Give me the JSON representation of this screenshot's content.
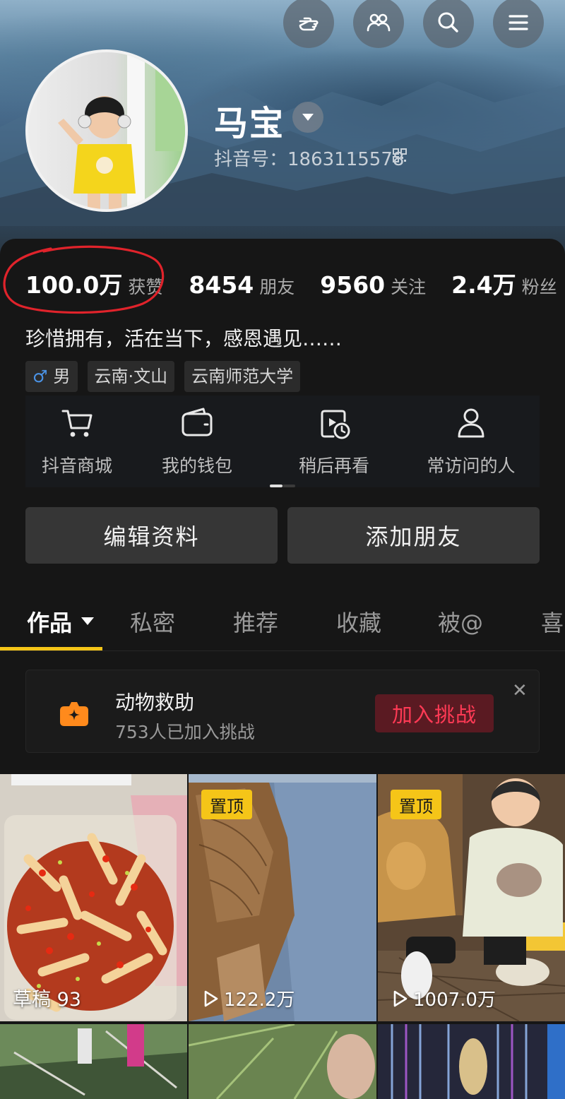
{
  "header": {
    "icons": [
      "finger-point-icon",
      "friends-icon",
      "search-icon",
      "menu-icon"
    ],
    "username": "马宝",
    "douyin_id_label": "抖音号：",
    "douyin_id": "1863115578"
  },
  "stats": [
    {
      "num": "100.0万",
      "label": "获赞"
    },
    {
      "num": "8454",
      "label": "朋友"
    },
    {
      "num": "9560",
      "label": "关注"
    },
    {
      "num": "2.4万",
      "label": "粉丝"
    }
  ],
  "bio": "珍惜拥有，活在当下，感恩遇见……",
  "tags": {
    "gender_symbol": "♂",
    "gender": "男",
    "location": "云南·文山",
    "school": "云南师范大学"
  },
  "quick_actions": [
    {
      "label": "抖音商城",
      "icon": "cart-icon"
    },
    {
      "label": "我的钱包",
      "icon": "wallet-icon"
    },
    {
      "label": "稍后再看",
      "icon": "watch-later-icon"
    },
    {
      "label": "常访问的人",
      "icon": "person-icon"
    }
  ],
  "buttons": {
    "edit": "编辑资料",
    "add_friend": "添加朋友"
  },
  "tabs": [
    "作品",
    "私密",
    "推荐",
    "收藏",
    "被@",
    "喜"
  ],
  "challenge": {
    "title": "动物救助",
    "subtitle": "753人已加入挑战",
    "join": "加入挑战",
    "close": "✕"
  },
  "videos": [
    {
      "badge": "",
      "draft_label": "草稿",
      "draft_count": "93",
      "plays": ""
    },
    {
      "badge": "置顶",
      "plays": "122.2万"
    },
    {
      "badge": "置顶",
      "plays": "1007.0万"
    }
  ],
  "colors": {
    "accent_yellow": "#f5c518",
    "join_red": "#ff3a55",
    "annotation_red": "#e0232b",
    "challenge_orange": "#ff8a1c"
  }
}
